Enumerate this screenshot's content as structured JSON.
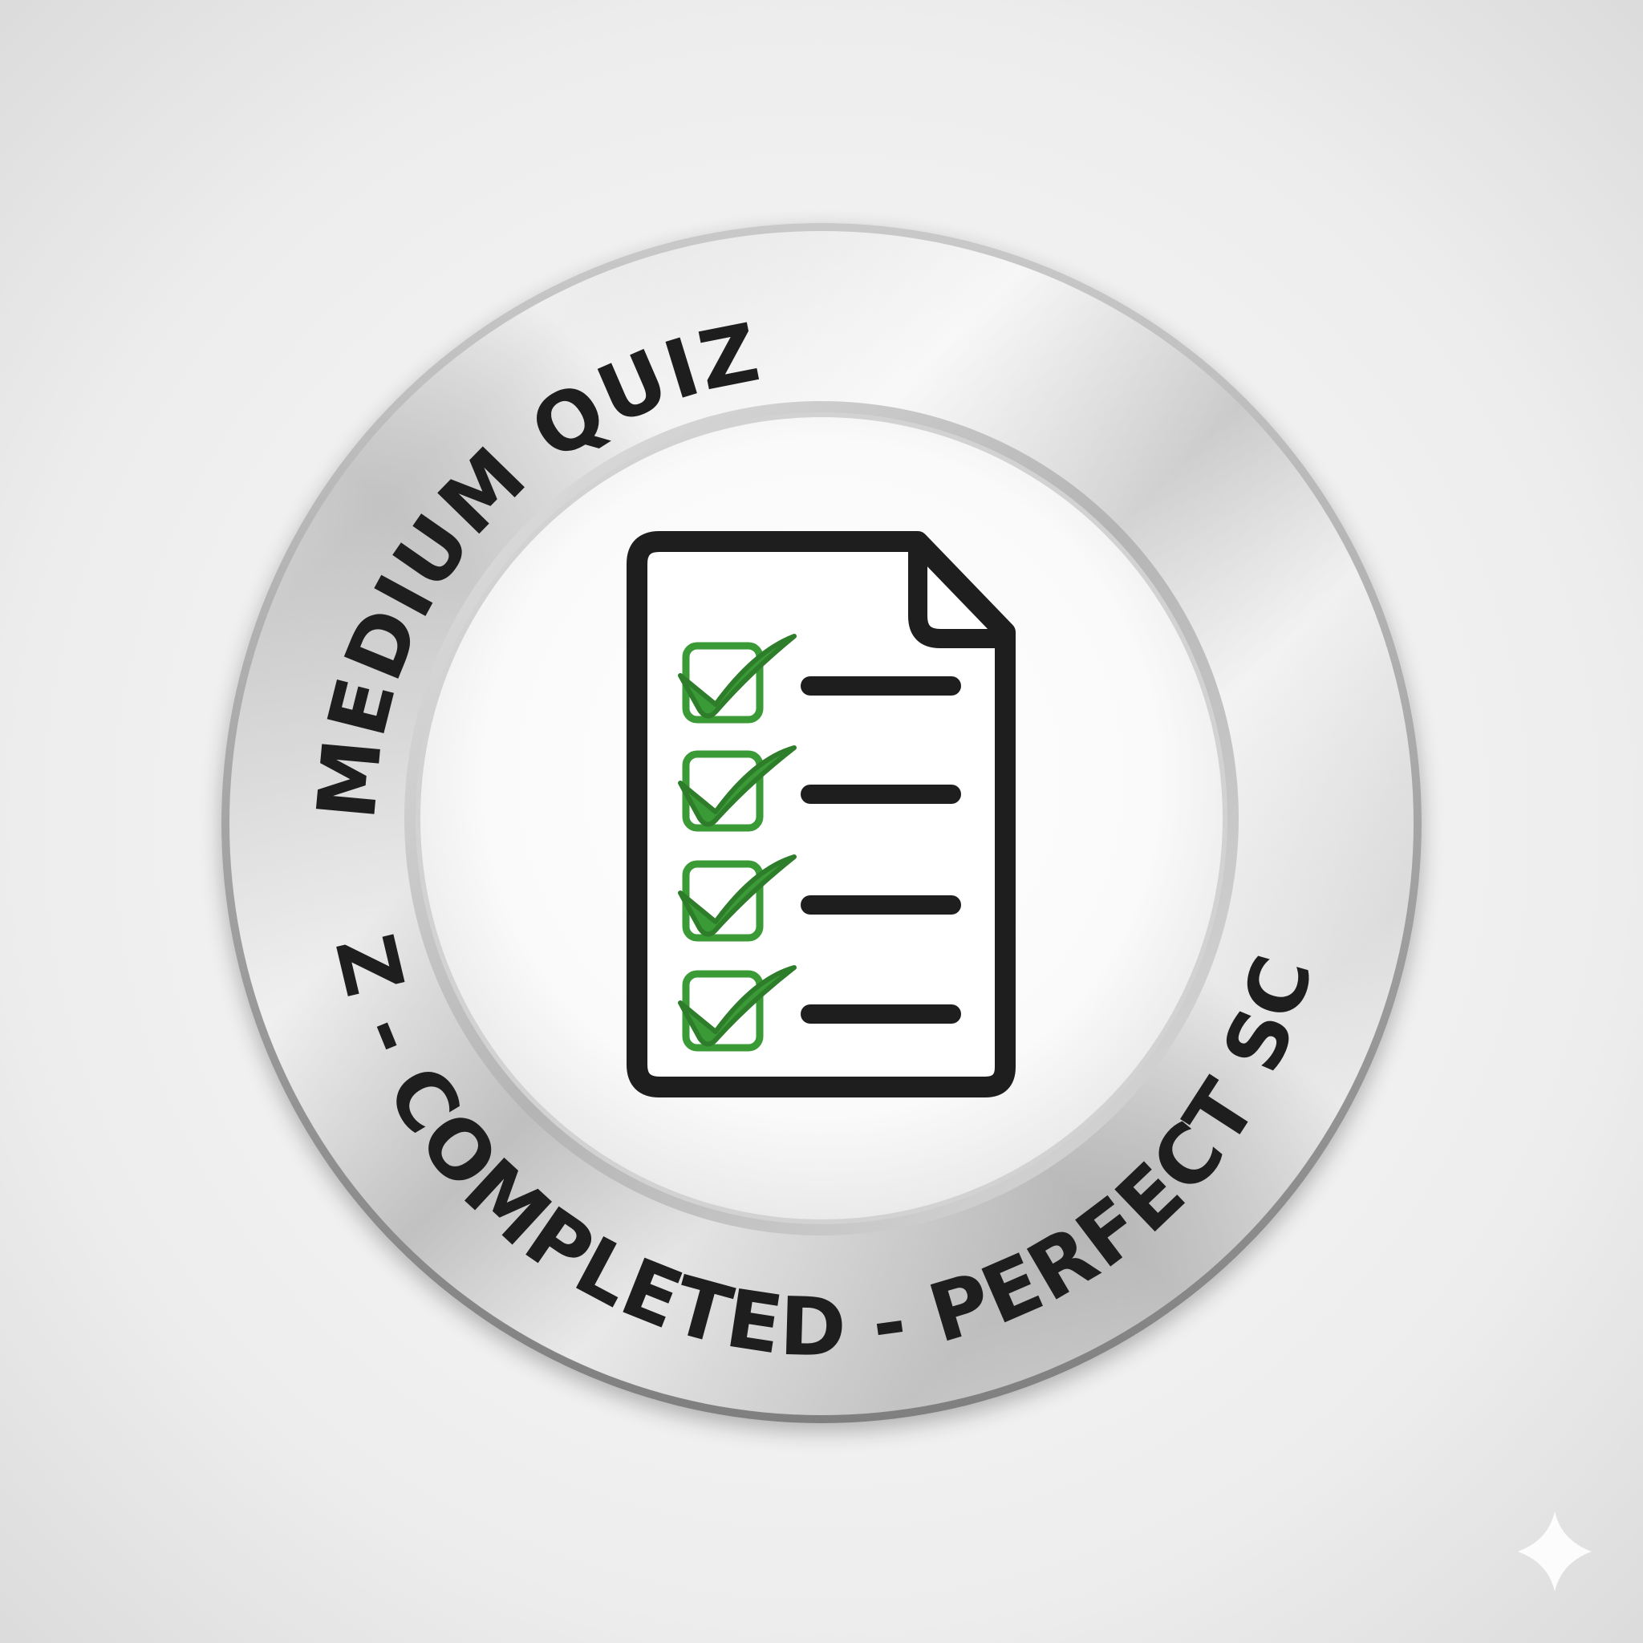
{
  "badge": {
    "top_text": "MEDIUM QUIZ",
    "bottom_text": "QUIZ - COMPLETED - PERFECT SCORE",
    "icon": "checklist-document-icon",
    "checked_items": 4,
    "total_items": 4,
    "colors": {
      "check_green": "#3a9a36",
      "check_green_dark": "#2e7d2b",
      "ink": "#1e1e1e",
      "metal_light": "#f7f7f7",
      "metal_mid": "#c9c9c9",
      "metal_dark": "#8f8f8f",
      "background": "#ececec"
    }
  },
  "watermark": {
    "icon": "sparkle-icon"
  }
}
